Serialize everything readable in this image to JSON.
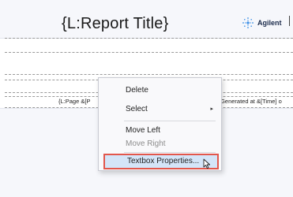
{
  "report": {
    "title": "{L:Report Title}",
    "logo_text": "Agilent",
    "footer_left": "{L:Page &[P",
    "footer_right": ":Generated at &[Time] o"
  },
  "context_menu": {
    "items": [
      {
        "label": "Delete"
      },
      {
        "label": "Select",
        "submenu_arrow": "▸"
      },
      {
        "label": "Move Left"
      },
      {
        "label": "Move Right"
      },
      {
        "label": "Textbox Properties..."
      }
    ]
  },
  "colors": {
    "highlight_border": "#e2574c",
    "highlight_fill": "#d4e5f8",
    "logo_spark": "#3a8ee6"
  },
  "icons": {
    "logo": "agilent-spark-icon",
    "cursor": "mouse-pointer-icon"
  }
}
